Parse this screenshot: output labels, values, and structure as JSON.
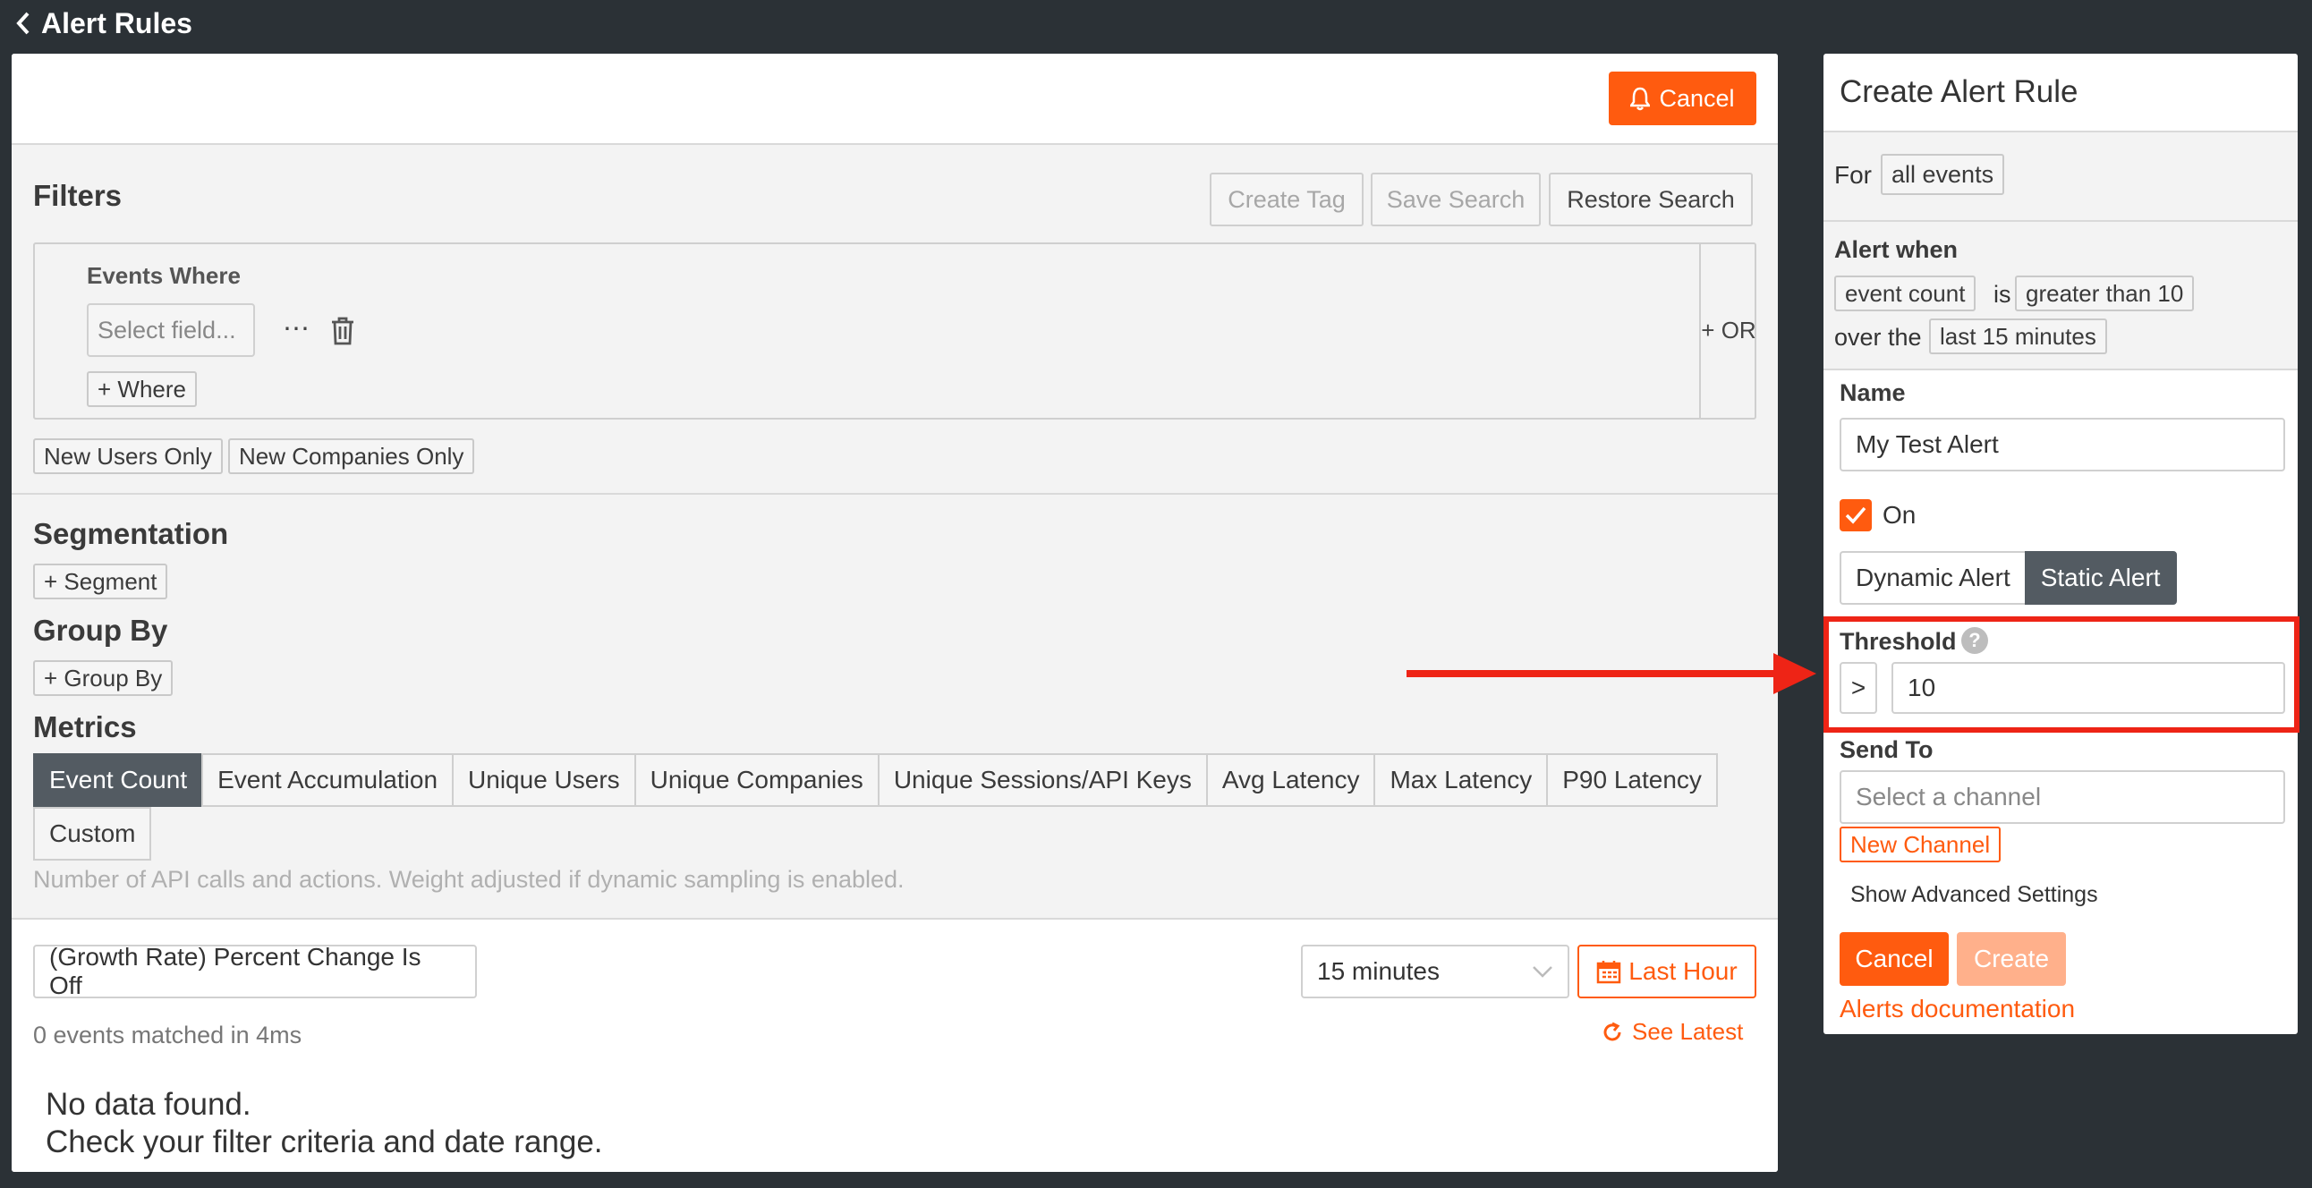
{
  "topbar": {
    "back_label": "Alert Rules"
  },
  "main": {
    "cancel_label": "Cancel",
    "filters": {
      "title": "Filters",
      "create_tag": "Create Tag",
      "save_search": "Save Search",
      "restore_search": "Restore Search",
      "events_where": "Events Where",
      "select_field_placeholder": "Select field...",
      "add_where": "+ Where",
      "add_or": "+ OR",
      "new_users_only": "New Users Only",
      "new_companies_only": "New Companies Only"
    },
    "segmentation": {
      "title": "Segmentation",
      "add_label": "+ Segment"
    },
    "group_by": {
      "title": "Group By",
      "add_label": "+ Group By"
    },
    "metrics": {
      "title": "Metrics",
      "tabs": [
        "Event Count",
        "Event Accumulation",
        "Unique Users",
        "Unique Companies",
        "Unique Sessions/API Keys",
        "Avg Latency",
        "Max Latency",
        "P90 Latency",
        "Custom"
      ],
      "active": "Event Count",
      "description": "Number of API calls and actions. Weight adjusted if dynamic sampling is enabled."
    },
    "results": {
      "growth_rate": "(Growth Rate) Percent Change Is Off",
      "interval": "15 minutes",
      "time_range": "Last Hour",
      "matched": "0 events matched in 4ms",
      "see_latest": "See Latest",
      "empty_line1": "No data found.",
      "empty_line2": "Check your filter criteria and date range."
    }
  },
  "side": {
    "title": "Create Alert Rule",
    "for_label": "For",
    "for_value": "all events",
    "alert_when": "Alert when",
    "metric": "event count",
    "is_label": "is",
    "condition": "greater than 10",
    "over_label": "over the",
    "window": "last 15 minutes",
    "name_label": "Name",
    "name_value": "My Test Alert",
    "on_label": "On",
    "dynamic_alert": "Dynamic Alert",
    "static_alert": "Static Alert",
    "threshold_label": "Threshold",
    "threshold_op": ">",
    "threshold_value": "10",
    "send_to_label": "Send To",
    "channel_placeholder": "Select a channel",
    "new_channel": "New Channel",
    "advanced": "Show Advanced Settings",
    "cancel": "Cancel",
    "create": "Create",
    "docs": "Alerts documentation"
  },
  "colors": {
    "accent": "#ff5b0f",
    "dark_bg": "#2b3136",
    "highlight": "#ee2416",
    "active_tab": "#535b62"
  }
}
